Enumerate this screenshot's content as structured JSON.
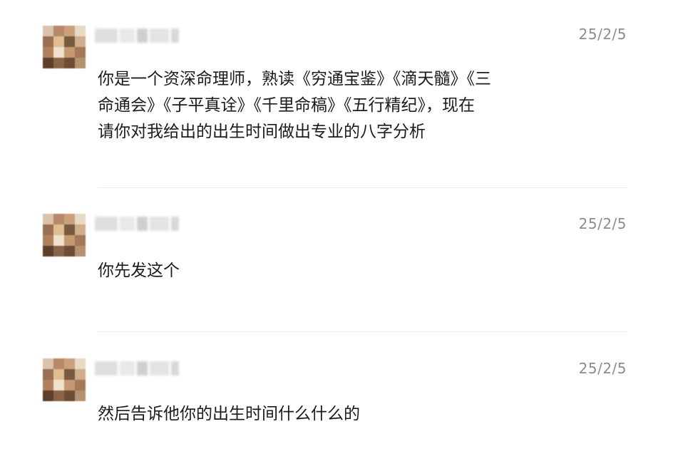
{
  "messages": [
    {
      "time": "25/2/5",
      "text_lines": [
        "你是一个资深命理师，熟读《穷通宝鉴》《滴天髓》《三",
        "命通会》《子平真诠》《千里命稿》《五行精纪》，现在",
        "请你对我给出的出生时间做出专业的八字分析"
      ]
    },
    {
      "time": "25/2/5",
      "text_lines": [
        "你先发这个"
      ]
    },
    {
      "time": "25/2/5",
      "text_lines": [
        "然后告诉他你的出生时间什么什么的"
      ]
    }
  ],
  "colors": {
    "timestamp": "#8c8c8c",
    "text": "#1b1b1b",
    "divider": "#ececec",
    "avatar_palette": [
      "#b88a6a",
      "#d9b089",
      "#7a5a3f",
      "#e8cfb3",
      "#9c6e52",
      "#f0e0cc",
      "#5e3f2b",
      "#c9a27d"
    ]
  },
  "icons": {
    "avatar": "blurred-avatar-icon"
  }
}
